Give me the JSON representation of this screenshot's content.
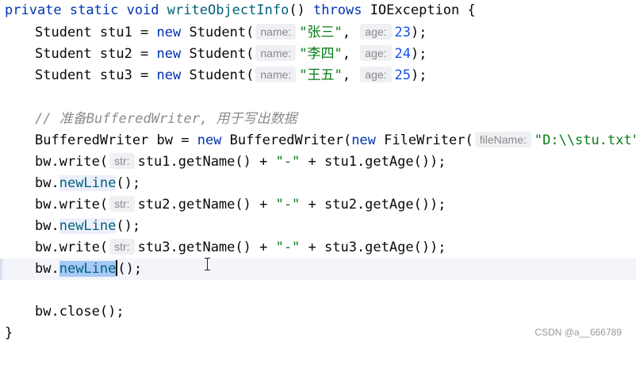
{
  "code": {
    "l1": {
      "kw1": "private",
      "kw2": "static",
      "kw3": "void",
      "method": "writeObjectInfo",
      "parens": "() ",
      "kw4": "throws",
      "rest": " IOException {"
    },
    "l2": {
      "a": "Student stu1 = ",
      "kw": "new",
      "b": " Student(",
      "h1": "name:",
      "s1": "\"张三\"",
      "c": ",",
      "h2": "age:",
      "n": "23",
      "d": ");"
    },
    "l3": {
      "a": "Student stu2 = ",
      "kw": "new",
      "b": " Student(",
      "h1": "name:",
      "s1": "\"李四\"",
      "c": ",",
      "h2": "age:",
      "n": "24",
      "d": ");"
    },
    "l4": {
      "a": "Student stu3 = ",
      "kw": "new",
      "b": " Student(",
      "h1": "name:",
      "s1": "\"王五\"",
      "c": ",",
      "h2": "age:",
      "n": "25",
      "d": ");"
    },
    "l6": {
      "comment": "// 准备BufferedWriter, 用于写出数据"
    },
    "l7": {
      "a": "BufferedWriter bw = ",
      "kw1": "new",
      "b": " BufferedWriter(",
      "kw2": "new",
      "c": " FileWriter(",
      "h": "fileName:",
      "s": "\"D:\\\\stu.txt\"",
      "d": "));"
    },
    "l8": {
      "a": "bw.write(",
      "h": "str:",
      "b": "stu1.getName() + ",
      "s": "\"-\"",
      "c": " + stu1.getAge());"
    },
    "l9": {
      "a": "bw.",
      "m": "newLine",
      "b": "();"
    },
    "l10": {
      "a": "bw.write(",
      "h": "str:",
      "b": "stu2.getName() + ",
      "s": "\"-\"",
      "c": " + stu2.getAge());"
    },
    "l11": {
      "a": "bw.",
      "m": "newLine",
      "b": "();"
    },
    "l12": {
      "a": "bw.write(",
      "h": "str:",
      "b": "stu3.getName() + ",
      "s": "\"-\"",
      "c": " + stu3.getAge());"
    },
    "l13": {
      "a": "bw.",
      "m": "newLine",
      "b": "();"
    },
    "l15": {
      "a": "bw.close();"
    },
    "l16": {
      "a": "}"
    }
  },
  "watermark": "CSDN @a__666789"
}
